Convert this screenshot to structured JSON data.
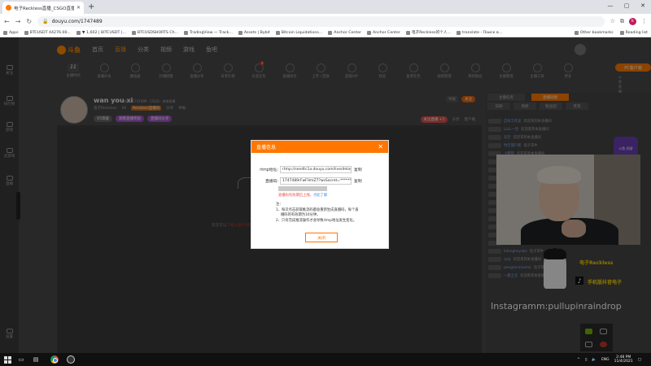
{
  "browser": {
    "tab_title": "电子Reckless直播_CSGO直播_CSG...",
    "url": "douyu.com/1747489",
    "bookmarks": [
      "Apps",
      "BTCUSDT 44276.00...",
      "▼ 1,602 | BITCUSDT |...",
      "BTCUSDSHORTS Ch...",
      "TradingView — Track...",
      "Assets | Bybit",
      "Bitcoin Liquidations...",
      "Anchor Center",
      "Anchor Center",
      "电子Reckless的个人...",
      "translate - Поиск в..."
    ],
    "other_bookmarks": "Other bookmarks",
    "reading_list": "Reading list",
    "profile_initial": "k"
  },
  "site": {
    "logo": "斗鱼",
    "nav": [
      "首页",
      "直播",
      "分类",
      "视频",
      "游戏",
      "鱼吧"
    ],
    "icon_row": [
      {
        "label": "主播时间",
        "num": "11"
      },
      {
        "label": "直播开关"
      },
      {
        "label": "播放器"
      },
      {
        "label": "开播提醒"
      },
      {
        "label": "直播分享"
      },
      {
        "label": "日常礼物"
      },
      {
        "label": "天选任务",
        "badge": "3"
      },
      {
        "label": "直播排名"
      },
      {
        "label": "上传 / 回放"
      },
      {
        "label": "超级VIP"
      },
      {
        "label": "粉丝"
      },
      {
        "label": "鱼吧任务"
      },
      {
        "label": "视频管理"
      },
      {
        "label": "我的粉丝"
      },
      {
        "label": "主播管理"
      },
      {
        "label": "主播工具"
      },
      {
        "label": "更多"
      }
    ],
    "pc_button": "PC客户端",
    "pc_sub": "斗鱼直播伴侣 开播工具",
    "sidebar": [
      "关注",
      "排行榜",
      "游戏",
      "云游戏",
      "直播",
      "设置"
    ]
  },
  "room": {
    "name": "wan you xi",
    "meta": "房间: 1747489 · CSGO · 体育赛事",
    "line2": [
      "电子Reckless",
      "26",
      "Reckless直播间",
      "分享",
      "举报"
    ],
    "tags": [
      "V5等级",
      "观看直播奖励",
      "直播间分享"
    ],
    "report": "举报",
    "follow": "关注",
    "stats": [
      "关注直播 +1",
      "分享",
      "客户端"
    ],
    "start_button": "开始直播",
    "video_hint_pre": "您还可以",
    "video_hint_link": "下载斗鱼PC端",
    "video_hint_post": "直播，获得纯净高清的观看体验"
  },
  "right_panel": {
    "tabs": [
      "主播任务",
      "直播间榜",
      "日榜",
      "周榜",
      "粉丝团",
      "贵宾"
    ],
    "chat": [
      {
        "user": "自有工作室",
        "text": "欢迎来到本直播间"
      },
      {
        "user": "LLLL一世",
        "text": "欢迎来到本直播间"
      },
      {
        "user": "天空",
        "text": "欢迎来到本直播间"
      },
      {
        "user": "时空旅行者",
        "text": "电子哥牛"
      },
      {
        "user": "小甜甜",
        "text": "欢迎来到本直播间"
      },
      {
        "user": "鱼友123",
        "text": "欢迎来到本直播间"
      },
      {
        "user": "一盘土豆",
        "text": "哈哈哈"
      },
      {
        "user": "观众007",
        "text": "欢迎来到本直播间"
      },
      {
        "user": "xiaoxiao",
        "text": "欢迎来到本直播间"
      },
      {
        "user": "斗鱼用户",
        "text": "欢迎来到本直播间"
      },
      {
        "user": "深海",
        "text": "欢迎来到本直播间"
      },
      {
        "user": "浪子",
        "text": "欢迎来到本直播间"
      },
      {
        "user": "阿狸",
        "text": "欢迎来到本直播间"
      },
      {
        "user": "咕咕",
        "text": "欢迎来到本直播间"
      },
      {
        "user": "小猫",
        "text": "欢迎来到本直播间"
      },
      {
        "user": "pengrenxiaomo",
        "text": "电子哥来直播了"
      },
      {
        "user": "lidongheyaka",
        "text": "电子哥牛"
      },
      {
        "user": "火山",
        "text": "欢迎来到本直播间"
      },
      {
        "user": "pengrenxiaomo",
        "text": "电子哥来直播了"
      },
      {
        "user": "一盘土豆",
        "text": "欢迎来到本直播间"
      }
    ],
    "promo": "斗鱼 网游"
  },
  "overlay": {
    "instagram": "Instagramm:pullupinraindrop",
    "handle1": "电子Reckless",
    "handle2": "手机版抖音电子"
  },
  "modal": {
    "title": "直播信息",
    "rtmp_label": "rtmp地址:",
    "rtmp_value": "rtmp://sendtc1a.douyu.com/live/delay",
    "key_label": "直播码:",
    "key_value": "1747489rFwFHmZ7?wsSecret=********",
    "copy": "复制",
    "warning": "直播码有效期已上线，",
    "warning_link": "点此了解",
    "notes": [
      "注：",
      "1、每次点击获取推流码都会重新生成直播码，每个直",
      "播码的有效期为10分钟。",
      "2、只有完成推流操作才会导致rtmp地址发生变化。"
    ],
    "close": "关闭"
  },
  "taskbar": {
    "time": "2:48 PM",
    "date": "11/4/2021",
    "lang": "ENG"
  }
}
